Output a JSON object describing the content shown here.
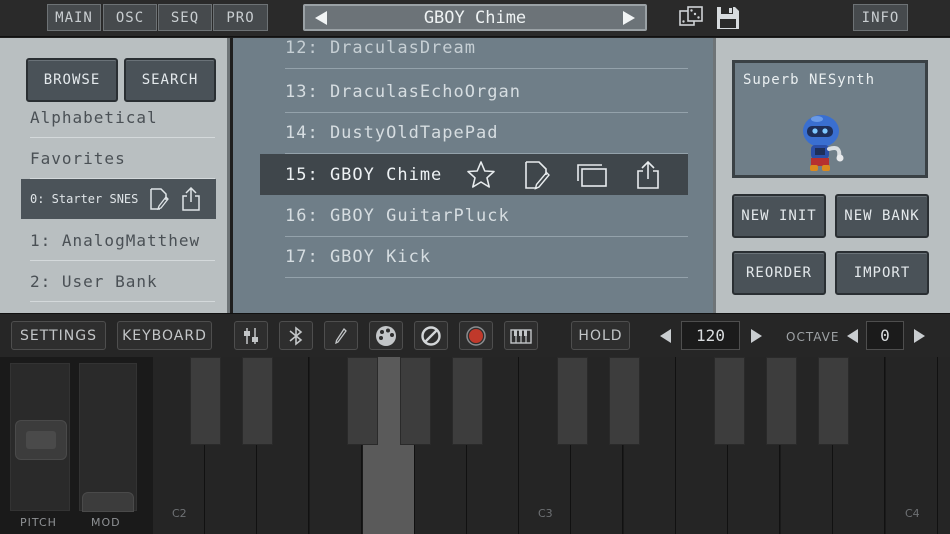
{
  "topbar": {
    "tabs": [
      {
        "label": "MAIN"
      },
      {
        "label": "OSC"
      },
      {
        "label": "SEQ"
      },
      {
        "label": "PRO"
      }
    ],
    "preset_name": "GBOY Chime",
    "info_label": "INFO"
  },
  "left_panel": {
    "browse_label": "BROWSE",
    "search_label": "SEARCH",
    "rows": [
      {
        "label": "Alphabetical"
      },
      {
        "label": "Favorites"
      },
      {
        "label": "0: Starter SNES"
      },
      {
        "label": "1: AnalogMatthew"
      },
      {
        "label": "2: User Bank"
      }
    ]
  },
  "preset_list": {
    "rows": [
      {
        "label": "12: DraculasDream"
      },
      {
        "label": "13: DraculasEchoOrgan"
      },
      {
        "label": "14: DustyOldTapePad"
      },
      {
        "label": "15: GBOY Chime"
      },
      {
        "label": "16: GBOY GuitarPluck"
      },
      {
        "label": "17: GBOY Kick"
      }
    ],
    "selected_index": 3
  },
  "right_panel": {
    "screen_title": "Superb NESynth",
    "new_init_label": "NEW INIT",
    "new_bank_label": "NEW BANK",
    "reorder_label": "REORDER",
    "import_label": "IMPORT"
  },
  "toolbar": {
    "settings_label": "SETTINGS",
    "keyboard_label": "KEYBOARD",
    "hold_label": "HOLD",
    "tempo": "120",
    "octave_label": "OCTAVE",
    "octave": "0"
  },
  "keyboard": {
    "pitch_label": "PITCH",
    "mod_label": "MOD",
    "note_labels": [
      "C2",
      "C3",
      "C4"
    ],
    "pressed_key_index": 4
  },
  "colors": {
    "panel_light": "#b9bfc1",
    "list_bg": "#6f7e88",
    "selected_row": "#3f464b",
    "record_red": "#c0392b"
  }
}
